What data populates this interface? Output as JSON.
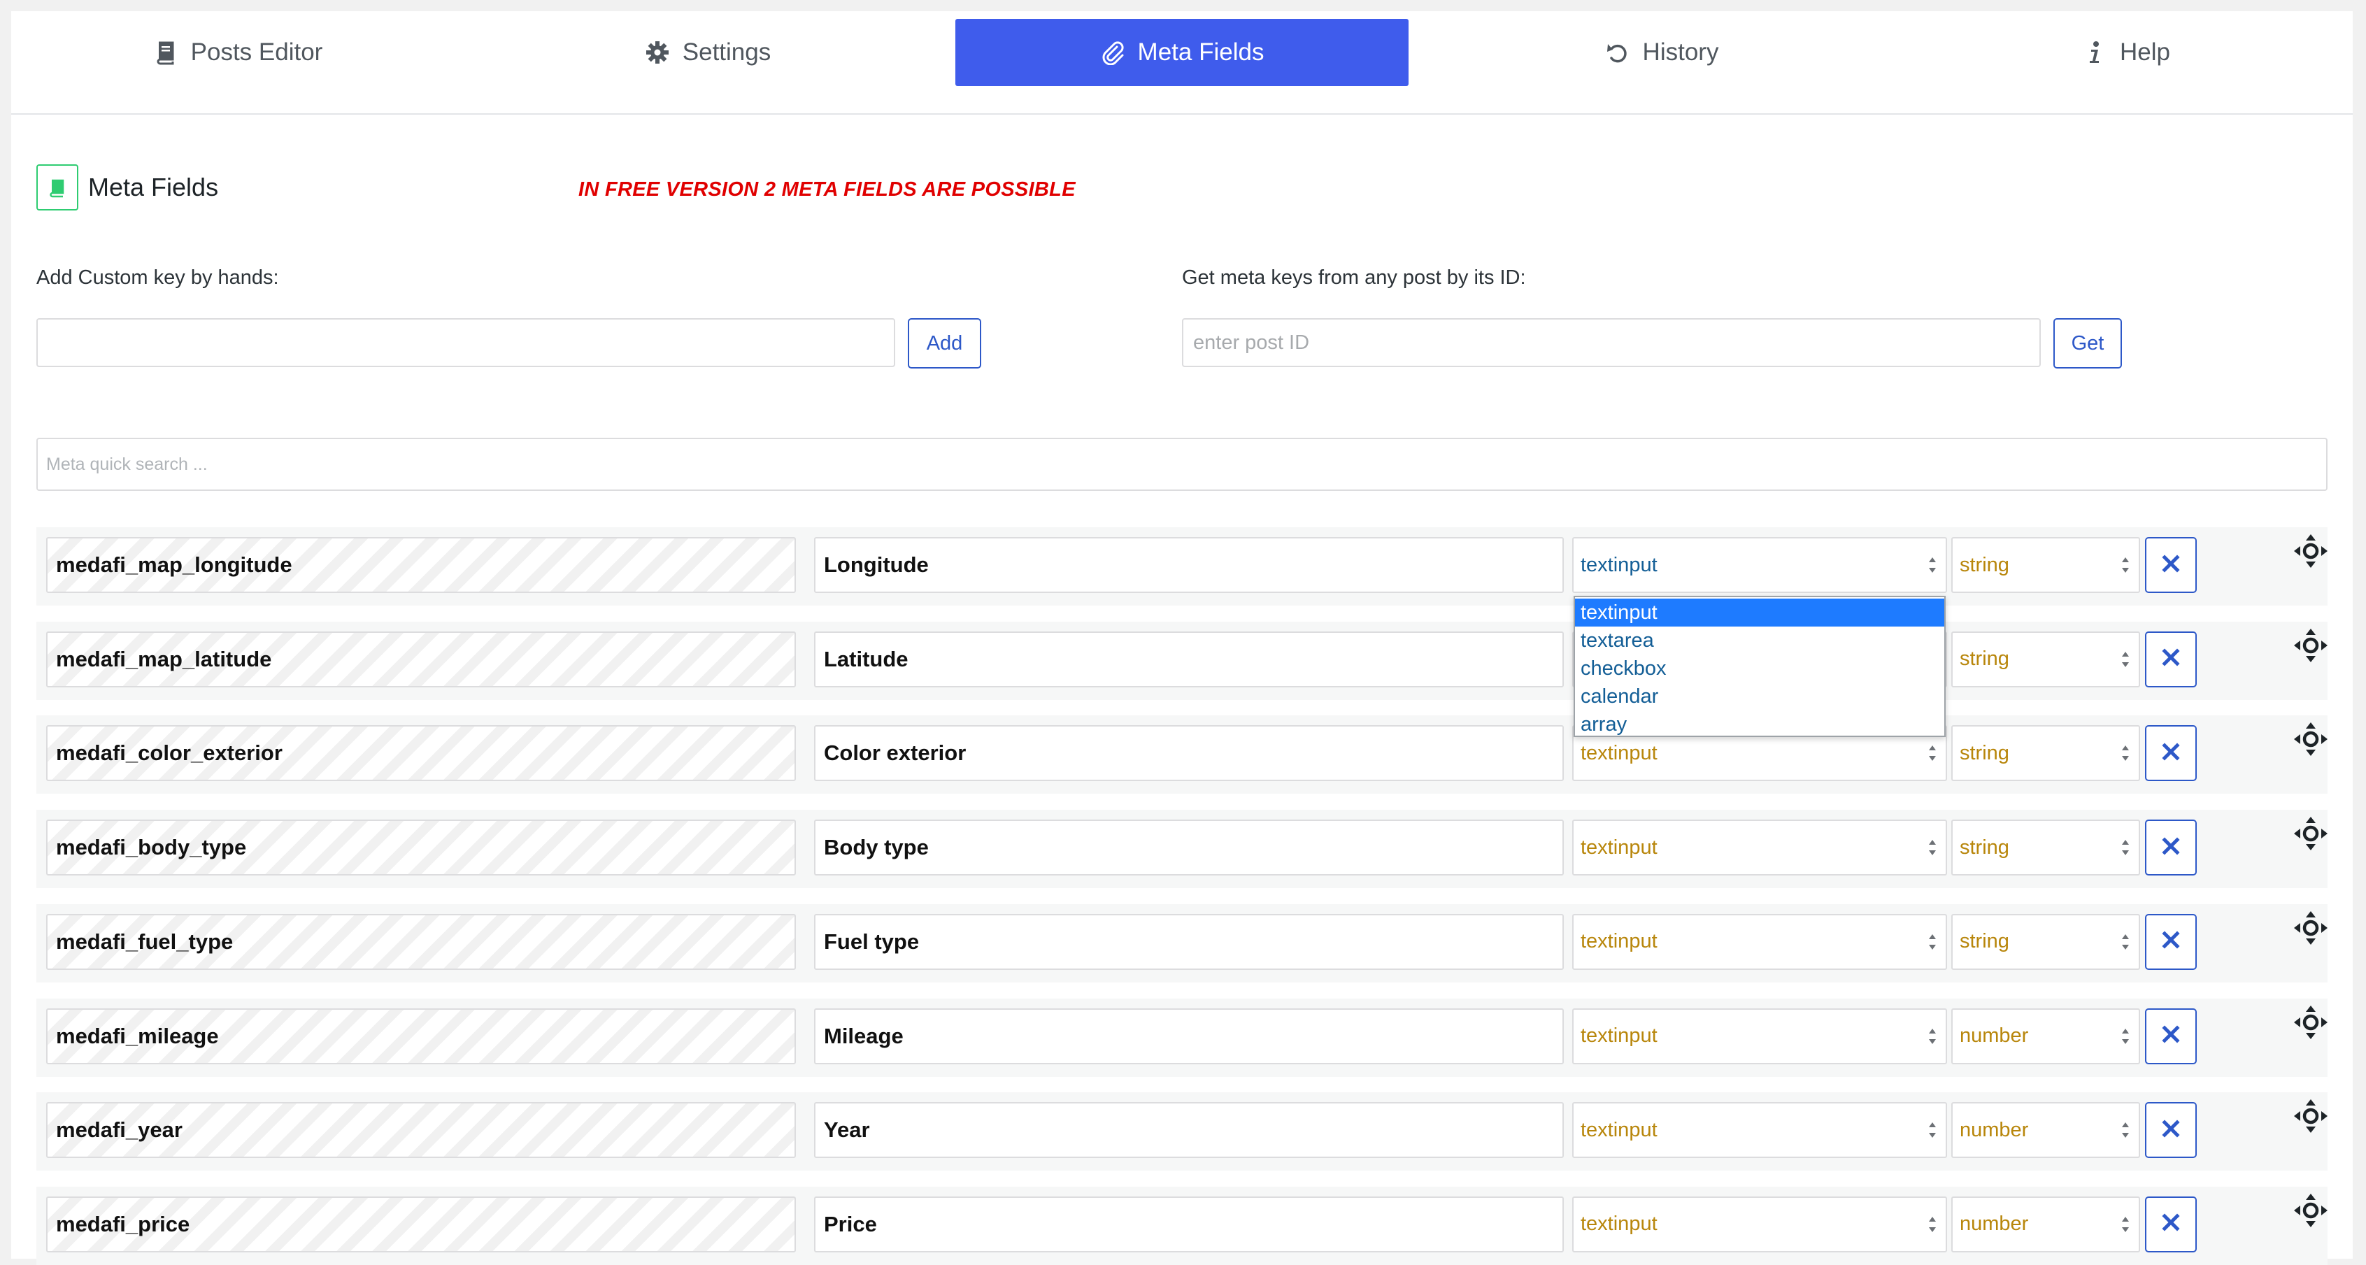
{
  "tabs": [
    {
      "label": "Posts Editor",
      "icon": "book-icon",
      "active": false
    },
    {
      "label": "Settings",
      "icon": "gear-icon",
      "active": false
    },
    {
      "label": "Meta Fields",
      "icon": "paperclip-icon",
      "active": true
    },
    {
      "label": "History",
      "icon": "undo-icon",
      "active": false
    },
    {
      "label": "Help",
      "icon": "info-icon",
      "active": false
    }
  ],
  "header": {
    "title": "Meta Fields",
    "notice": "IN FREE VERSION 2 META FIELDS ARE POSSIBLE"
  },
  "custom_key": {
    "label": "Add Custom key by hands:",
    "value": "",
    "button": "Add"
  },
  "post_id": {
    "label": "Get meta keys from any post by its ID:",
    "placeholder": "enter post ID",
    "button": "Get"
  },
  "search": {
    "placeholder": "Meta quick search ..."
  },
  "rows": [
    {
      "key": "medafi_map_longitude",
      "label": "Longitude",
      "field_type": "textinput",
      "data_type": "string"
    },
    {
      "key": "medafi_map_latitude",
      "label": "Latitude",
      "field_type": "textinput",
      "data_type": "string"
    },
    {
      "key": "medafi_color_exterior",
      "label": "Color exterior",
      "field_type": "textinput",
      "data_type": "string"
    },
    {
      "key": "medafi_body_type",
      "label": "Body type",
      "field_type": "textinput",
      "data_type": "string"
    },
    {
      "key": "medafi_fuel_type",
      "label": "Fuel type",
      "field_type": "textinput",
      "data_type": "string"
    },
    {
      "key": "medafi_mileage",
      "label": "Mileage",
      "field_type": "textinput",
      "data_type": "number"
    },
    {
      "key": "medafi_year",
      "label": "Year",
      "field_type": "textinput",
      "data_type": "number"
    },
    {
      "key": "medafi_price",
      "label": "Price",
      "field_type": "textinput",
      "data_type": "number"
    }
  ],
  "dropdown": {
    "options": [
      "textinput",
      "textarea",
      "checkbox",
      "calendar",
      "array"
    ],
    "selected": "textinput"
  },
  "colors": {
    "accent": "#3f5cec",
    "button_border": "#2d58c8",
    "notice": "#e00000",
    "select_text": "#b8860b",
    "dropdown_highlight": "#1e7bff"
  }
}
